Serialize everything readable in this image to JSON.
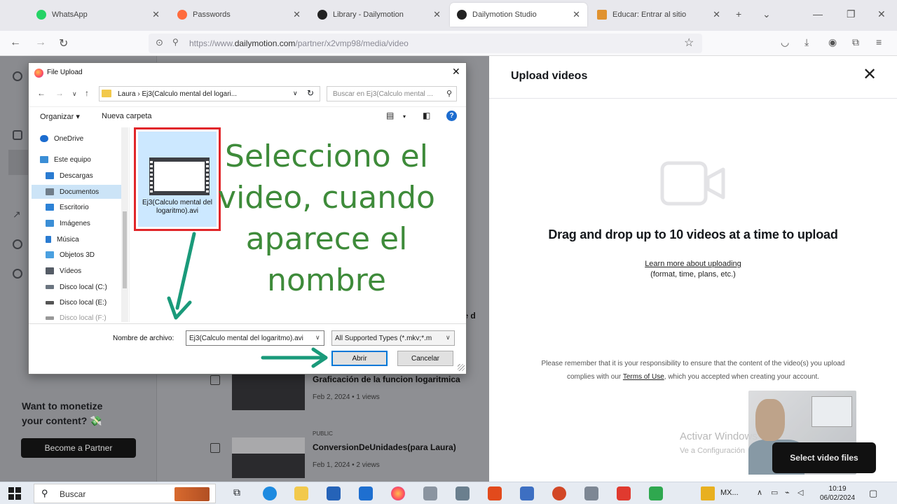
{
  "browser": {
    "tabs": [
      {
        "label": "WhatsApp",
        "color": "#25d366"
      },
      {
        "label": "Passwords",
        "color": "#ff6b3d"
      },
      {
        "label": "Library - Dailymotion",
        "color": "#222222"
      },
      {
        "label": "Dailymotion Studio",
        "color": "#222222",
        "active": true
      },
      {
        "label": "Educar: Entrar al sitio",
        "color": "#e0922f"
      }
    ],
    "url_prefix": "https://www.",
    "url_domain": "dailymotion.com",
    "url_path": "/partner/x2vmp98/media/video"
  },
  "page": {
    "monetize_line1": "Want to monetize",
    "monetize_line2": "your content? 💸",
    "partner_button": "Become a Partner",
    "videos": [
      {
        "tag": "",
        "title": "Graficación de la funcion logaritmica",
        "meta": "Feb 2, 2024 • 1 views"
      },
      {
        "tag": "PUBLIC",
        "title": "ConversionDeUnidades(para Laura)",
        "meta": "Feb 1, 2024 • 2 views"
      }
    ],
    "partial_title": "de d"
  },
  "upload_panel": {
    "title": "Upload videos",
    "drag_text": "Drag and drop up to 10 videos at a time to upload",
    "learn_line1": "Learn more about uploading",
    "learn_line2": "(format, time, plans, etc.)",
    "disclaimer_1": "Please remember that it is your responsibility to ensure that the content of the video(s) you upload",
    "disclaimer_2": "complies with our",
    "terms_link": "Terms of Use",
    "disclaimer_3": ", which you accepted when creating your account.",
    "select_button": "Select video files",
    "watermark_1": "Activar Windows",
    "watermark_2": "Ve a Configuración"
  },
  "dialog": {
    "title": "File Upload",
    "path": "Laura  ›  Ej3(Calculo mental del logari...",
    "search_placeholder": "Buscar en Ej3(Calculo mental ...",
    "organize": "Organizar ▾",
    "new_folder": "Nueva carpeta",
    "nav_items": [
      {
        "label": "OneDrive",
        "color": "#1c6ccf"
      },
      {
        "label": "Este equipo",
        "color": "#3b8ed6"
      },
      {
        "label": "Descargas",
        "color": "#2a7bd1"
      },
      {
        "label": "Documentos",
        "color": "#6f7d8a",
        "selected": true
      },
      {
        "label": "Escritorio",
        "color": "#2d82d6"
      },
      {
        "label": "Imágenes",
        "color": "#3b8ed6"
      },
      {
        "label": "Música",
        "color": "#2a7bd1"
      },
      {
        "label": "Objetos 3D",
        "color": "#4aa0e0"
      },
      {
        "label": "Vídeos",
        "color": "#555c66"
      },
      {
        "label": "Disco local (C:)",
        "color": "#6b7580"
      },
      {
        "label": "Disco local (E:)",
        "color": "#555555"
      },
      {
        "label": "Disco local (F:)",
        "color": "#555555"
      }
    ],
    "file_name": "Ej3(Calculo mental del logaritmo).avi",
    "annotation": "Selecciono el video, cuando aparece el nombre",
    "filename_label": "Nombre de archivo:",
    "filename_value": "Ej3(Calculo mental del logaritmo).avi",
    "filetype": "All Supported Types (*.mkv;*.m",
    "open_button": "Abrir",
    "cancel_button": "Cancelar"
  },
  "taskbar": {
    "search_label": "Buscar",
    "mx_label": "MX...",
    "time": "10:19",
    "date": "06/02/2024"
  },
  "colors": {
    "annotation_green": "#3e8b3a",
    "arrow_teal": "#1a9a7a",
    "highlight_red": "#e1262a"
  }
}
